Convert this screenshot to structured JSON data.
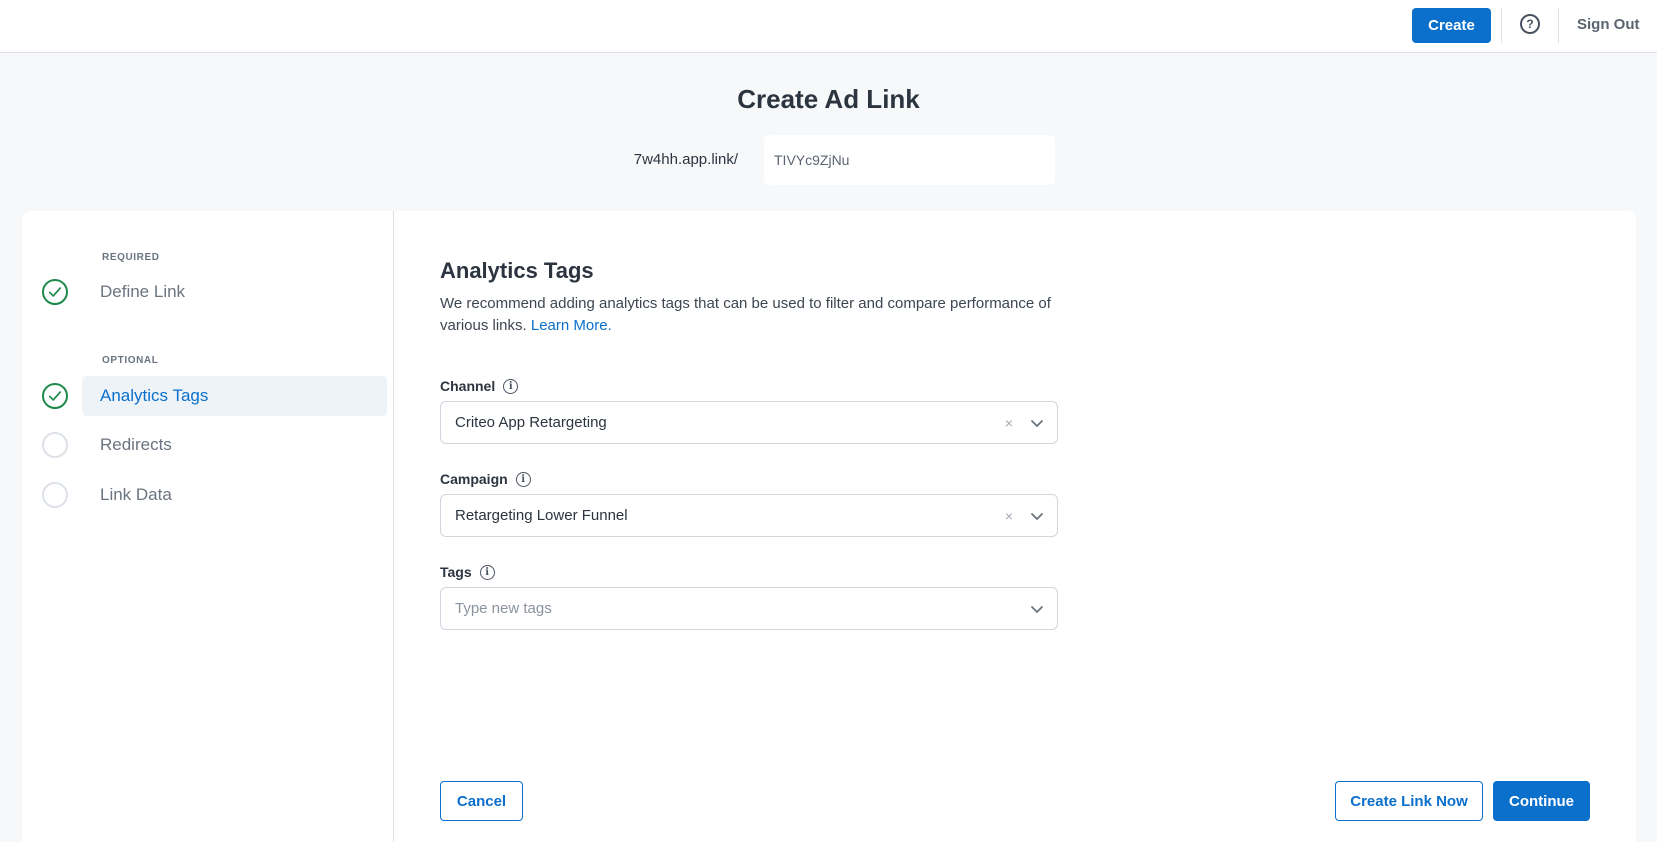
{
  "topbar": {
    "create_label": "Create",
    "help_glyph": "?",
    "signout_label": "Sign Out"
  },
  "header": {
    "title": "Create Ad Link",
    "domain_prefix": "7w4hh.app.link/",
    "alias_value": "TIVYc9ZjNu"
  },
  "sidebar": {
    "required_label": "REQUIRED",
    "optional_label": "OPTIONAL",
    "steps": [
      {
        "label": "Define Link",
        "status": "done"
      },
      {
        "label": "Analytics Tags",
        "status": "done-active"
      },
      {
        "label": "Redirects",
        "status": "pending"
      },
      {
        "label": "Link Data",
        "status": "pending"
      }
    ]
  },
  "content": {
    "title": "Analytics Tags",
    "description": "We recommend adding analytics tags that can be used to filter and compare performance of various links.",
    "learn_more": "Learn More.",
    "fields": {
      "channel": {
        "label": "Channel",
        "value": "Criteo App Retargeting",
        "clear_glyph": "×"
      },
      "campaign": {
        "label": "Campaign",
        "value": "Retargeting Lower Funnel",
        "clear_glyph": "×"
      },
      "tags": {
        "label": "Tags",
        "placeholder": "Type new tags"
      }
    },
    "info_glyph": "i"
  },
  "footer": {
    "cancel_label": "Cancel",
    "create_now_label": "Create Link Now",
    "continue_label": "Continue"
  },
  "colors": {
    "accent": "#0b6fcc",
    "success": "#1f8a4c",
    "background": "#f6f8fa"
  }
}
